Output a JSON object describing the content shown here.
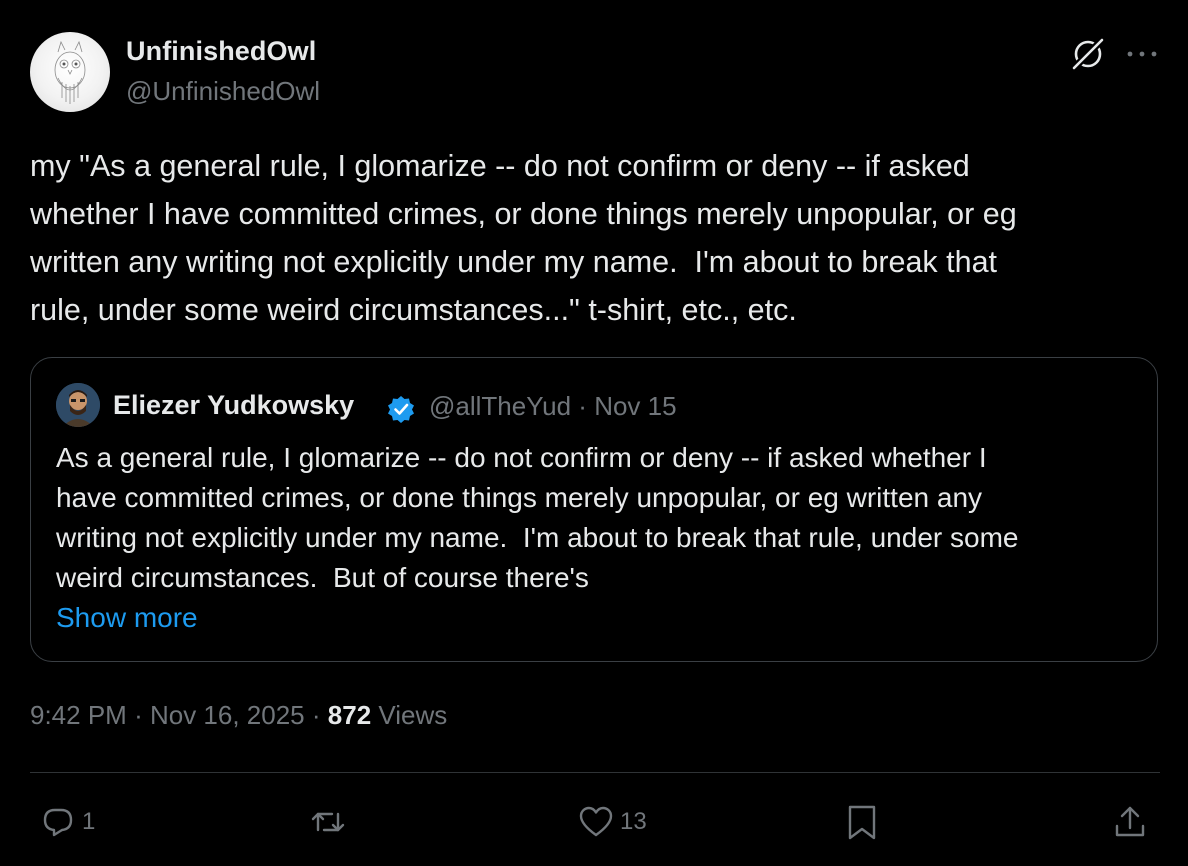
{
  "author": {
    "name": "UnfinishedOwl",
    "handle": "@UnfinishedOwl"
  },
  "tweet": {
    "text": "my \"As a general rule, I glomarize -- do not confirm or deny -- if asked\nwhether I have committed crimes, or done things merely unpopular, or eg\nwritten any writing not explicitly under my name.  I'm about to break that\nrule, under some weird circumstances...\" t-shirt, etc., etc."
  },
  "quote": {
    "name": "Eliezer Yudkowsky",
    "handle": "@allTheYud",
    "separator": "·",
    "date": "Nov 15",
    "text": "As a general rule, I glomarize -- do not confirm or deny -- if asked whether I\nhave committed crimes, or done things merely unpopular, or eg written any\nwriting not explicitly under my name.  I'm about to break that rule, under some\nweird circumstances.  But of course there's",
    "show_more": "Show more"
  },
  "meta": {
    "time": "9:42 PM",
    "date": "Nov 16, 2025",
    "separator": "·",
    "views_count": "872",
    "views_label": "Views"
  },
  "actions": {
    "reply_count": "1",
    "like_count": "13"
  },
  "icons": {
    "header": [
      "grok-icon",
      "more-icon"
    ],
    "actions": [
      "reply-icon",
      "retweet-icon",
      "like-icon",
      "bookmark-icon",
      "share-icon"
    ]
  },
  "colors": {
    "background": "#000000",
    "text": "#e7e9ea",
    "muted": "#71767b",
    "link": "#1d9bf0",
    "border": "#2f3336"
  }
}
